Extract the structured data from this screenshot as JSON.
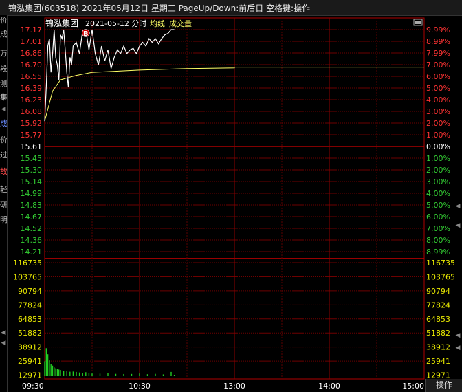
{
  "window": {
    "title": "锦泓集团(603518) 2021年05月12日 星期三 PageUp/Down:前后日 空格键:操作"
  },
  "header": {
    "stock_name": "锦泓集团",
    "date_label": "2021-05-12 分时",
    "avg_line_label": "均线",
    "volume_label": "成交量"
  },
  "left_strip": {
    "chars": [
      "价",
      "成",
      "万",
      "段",
      "测",
      "集",
      "成",
      "价",
      "过",
      "故",
      "轻",
      "研",
      "明"
    ],
    "red_index": [
      9
    ],
    "blue_index": [
      6
    ]
  },
  "price_axis": {
    "prices": [
      "17.17",
      "17.01",
      "16.86",
      "16.70",
      "16.55",
      "16.39",
      "16.23",
      "16.08",
      "15.92",
      "15.77",
      "15.61",
      "15.45",
      "15.30",
      "15.14",
      "14.99",
      "14.83",
      "14.67",
      "14.52",
      "14.36",
      "14.21"
    ],
    "percents": [
      "9.99%",
      "8.99%",
      "7.99%",
      "7.00%",
      "6.00%",
      "5.00%",
      "4.00%",
      "3.00%",
      "2.00%",
      "1.00%",
      "0.00%",
      "1.00%",
      "2.00%",
      "3.00%",
      "4.00%",
      "5.00%",
      "6.00%",
      "7.00%",
      "8.00%",
      "8.99%"
    ]
  },
  "volume_axis": {
    "labels": [
      "116735",
      "103765",
      "90794",
      "77824",
      "64853",
      "51882",
      "38912",
      "25941",
      "12971"
    ]
  },
  "time_axis": {
    "labels": [
      "09:30",
      "10:30",
      "13:00",
      "14:00",
      "15:00"
    ]
  },
  "marker": {
    "label": "B"
  },
  "buttons": {
    "operate": "操作"
  },
  "colors": {
    "background": "#000000",
    "grid": "#8b0000",
    "price_up": "#ff3333",
    "price_down": "#33cc33",
    "price_line": "#ffffff",
    "avg_line": "#ffff66",
    "volume": "#22cc22",
    "title_bar": "#1a1a1a"
  },
  "chart_data": {
    "type": "line",
    "pre_close": 15.61,
    "ylim": [
      14.21,
      17.17
    ],
    "series": [
      {
        "name": "",
        "x": [
          "09:30",
          "09:31",
          "09:32",
          "09:33",
          "09:34",
          "09:35",
          "09:36",
          "09:37",
          "09:38",
          "09:39",
          "09:40",
          "09:41",
          "09:42",
          "09:43",
          "09:44",
          "09:45",
          "09:46",
          "09:47",
          "09:48",
          "09:50",
          "09:52",
          "09:54",
          "09:56",
          "09:58",
          "10:00",
          "10:02",
          "10:04",
          "10:06",
          "10:08",
          "10:10",
          "10:12",
          "10:14",
          "10:16",
          "10:18",
          "10:20",
          "10:22",
          "10:24",
          "10:26",
          "10:28",
          "10:30",
          "10:32",
          "10:34",
          "10:36",
          "10:38",
          "10:40",
          "10:42",
          "10:44",
          "10:46",
          "10:48",
          "10:50",
          "10:52"
        ],
        "values": [
          15.95,
          16.4,
          16.95,
          17.05,
          16.6,
          16.85,
          17.17,
          16.8,
          16.7,
          16.5,
          17.1,
          17.05,
          17.17,
          16.9,
          16.6,
          16.4,
          16.8,
          16.7,
          16.95,
          17.0,
          16.85,
          17.15,
          17.17,
          16.9,
          17.17,
          16.85,
          16.7,
          16.95,
          16.75,
          16.9,
          16.65,
          16.8,
          16.9,
          16.85,
          16.95,
          16.85,
          16.9,
          16.92,
          16.85,
          16.95,
          17.0,
          16.95,
          17.05,
          17.0,
          17.05,
          16.98,
          17.05,
          17.1,
          17.12,
          17.17,
          17.17
        ]
      },
      {
        "name": "均线",
        "x": [
          "09:30",
          "09:35",
          "09:40",
          "09:45",
          "09:50",
          "10:00",
          "10:10",
          "10:20",
          "10:30",
          "11:00",
          "11:30",
          "13:00",
          "14:00",
          "15:00"
        ],
        "values": [
          15.95,
          16.35,
          16.5,
          16.53,
          16.56,
          16.6,
          16.61,
          16.62,
          16.63,
          16.65,
          16.66,
          16.67,
          16.67,
          16.67
        ]
      }
    ],
    "volume": {
      "x": [
        "09:30",
        "09:31",
        "09:32",
        "09:33",
        "09:34",
        "09:35",
        "09:36",
        "09:37",
        "09:38",
        "09:39",
        "09:40",
        "09:42",
        "09:44",
        "09:46",
        "09:48",
        "09:50",
        "09:52",
        "09:54",
        "09:56",
        "09:58",
        "10:00",
        "10:05",
        "10:10",
        "10:15",
        "10:20",
        "10:25",
        "10:30",
        "10:35",
        "10:40",
        "10:45",
        "10:50",
        "10:52"
      ],
      "values": [
        17000,
        32000,
        25000,
        18000,
        14000,
        12000,
        10000,
        9000,
        8500,
        7500,
        7000,
        6000,
        5500,
        5000,
        5200,
        4800,
        4200,
        3800,
        4500,
        3600,
        3000,
        2800,
        3200,
        2600,
        2400,
        2500,
        3000,
        2200,
        2600,
        2000,
        4800,
        1500
      ]
    },
    "volume_ylim": [
      0,
      129706
    ]
  }
}
